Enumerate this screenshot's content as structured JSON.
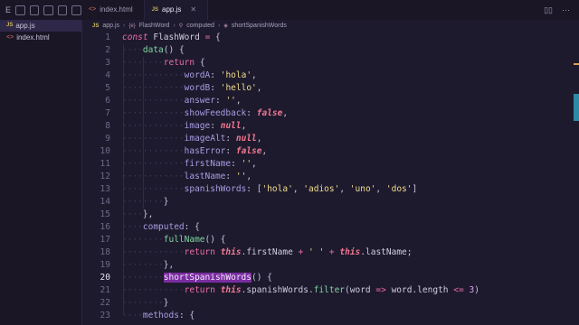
{
  "sidebar": {
    "toolbar_letter": "E",
    "files": [
      {
        "name": "app.js",
        "type": "JS",
        "active": true
      },
      {
        "name": "index.html",
        "type": "html",
        "active": false
      }
    ]
  },
  "tabs": [
    {
      "label": "index.html",
      "icon": "html-icon",
      "active": false
    },
    {
      "label": "app.js",
      "icon": "JS",
      "active": true
    }
  ],
  "breadcrumb": {
    "file": "app.js",
    "symbol1": "FlashWord",
    "symbol2": "computed",
    "symbol3": "shortSpanishWords"
  },
  "editor": {
    "current_line": 20,
    "lines": [
      {
        "n": "1"
      },
      {
        "n": "2"
      },
      {
        "n": "3"
      },
      {
        "n": "4"
      },
      {
        "n": "5"
      },
      {
        "n": "6"
      },
      {
        "n": "7"
      },
      {
        "n": "8"
      },
      {
        "n": "9"
      },
      {
        "n": "10"
      },
      {
        "n": "11"
      },
      {
        "n": "12"
      },
      {
        "n": "13"
      },
      {
        "n": "14"
      },
      {
        "n": "15"
      },
      {
        "n": "16"
      },
      {
        "n": "17"
      },
      {
        "n": "18"
      },
      {
        "n": "19"
      },
      {
        "n": "20"
      },
      {
        "n": "21"
      },
      {
        "n": "22"
      },
      {
        "n": "23"
      }
    ]
  },
  "colors": {
    "background": "#1e1a2e",
    "keyword": "#e86fa3",
    "function": "#7dd6a0",
    "property": "#a79de0",
    "string": "#f0dd8a",
    "highlight": "#7a2da0",
    "scroll_thumb": "#2c8aa6"
  }
}
